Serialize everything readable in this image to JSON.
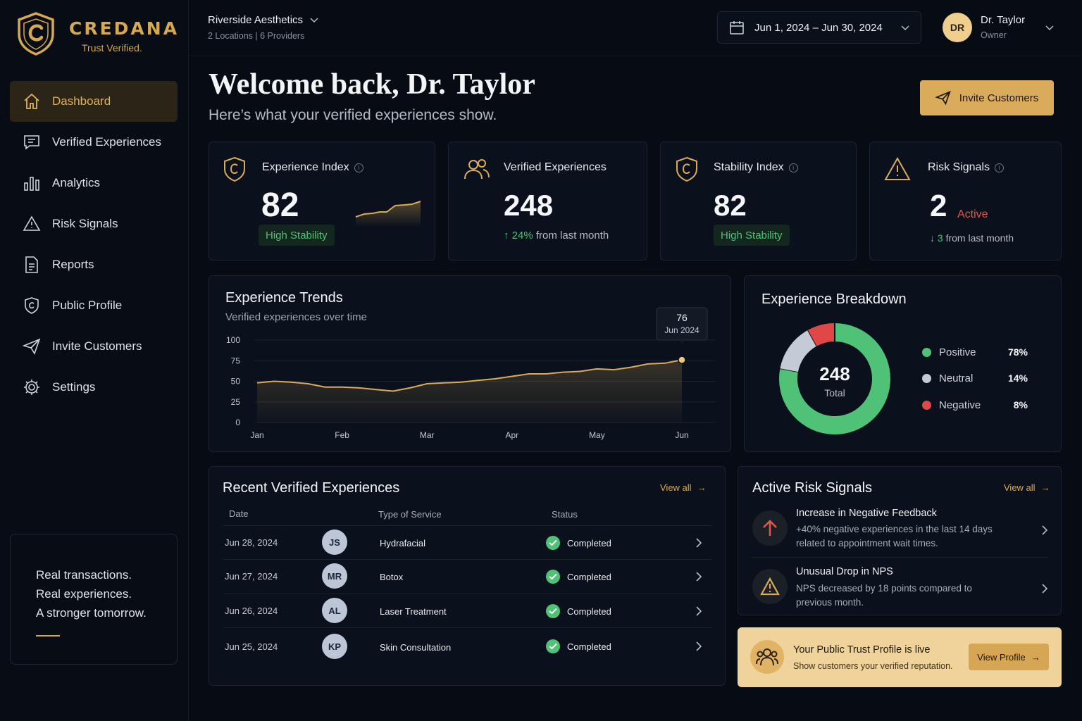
{
  "brand": {
    "name": "CREDANA",
    "tagline": "Trust Verified."
  },
  "sidebar": {
    "items": [
      {
        "label": "Dashboard",
        "icon": "home-icon"
      },
      {
        "label": "Verified Experiences",
        "icon": "message-icon"
      },
      {
        "label": "Analytics",
        "icon": "bar-chart-icon"
      },
      {
        "label": "Risk Signals",
        "icon": "warning-icon"
      },
      {
        "label": "Reports",
        "icon": "document-icon"
      },
      {
        "label": "Public Profile",
        "icon": "shield-icon"
      },
      {
        "label": "Invite Customers",
        "icon": "send-icon"
      },
      {
        "label": "Settings",
        "icon": "gear-icon"
      }
    ],
    "quote": [
      "Real transactions.",
      "Real experiences.",
      "A stronger tomorrow."
    ]
  },
  "header": {
    "org_name": "Riverside Aesthetics",
    "org_sub": "2 Locations  |  6 Providers",
    "date_range": "Jun 1, 2024 – Jun 30, 2024",
    "user_initials": "DR",
    "user_name": "Dr. Taylor",
    "user_role": "Owner"
  },
  "main": {
    "welcome": "Welcome back, Dr. Taylor",
    "welcome_sub": "Here’s what your verified experiences show.",
    "invite_label": "Invite Customers"
  },
  "kpis": {
    "experience_index": {
      "title": "Experience Index",
      "value": "82",
      "badge": "High Stability"
    },
    "verified": {
      "title": "Verified Experiences",
      "value": "248",
      "delta": "24%",
      "delta_text": "from last month"
    },
    "stability": {
      "title": "Stability Index",
      "value": "82",
      "badge": "High Stability"
    },
    "risk": {
      "title": "Risk Signals",
      "value": "2",
      "status": "Active",
      "delta": "3",
      "delta_text": "from last month"
    }
  },
  "trends": {
    "title": "Experience Trends",
    "subtitle": "Verified experiences over time",
    "tooltip_value": "76",
    "tooltip_label": "Jun 2024"
  },
  "chart_data": {
    "type": "area",
    "title": "Experience Trends",
    "subtitle": "Verified experiences over time",
    "categories": [
      "Jan",
      "Feb",
      "Mar",
      "Apr",
      "May",
      "Jun"
    ],
    "x": [
      0,
      0.2,
      0.4,
      0.6,
      0.8,
      1,
      1.2,
      1.4,
      1.6,
      1.8,
      2,
      2.2,
      2.4,
      2.6,
      2.8,
      3,
      3.2,
      3.4,
      3.6,
      3.8,
      4,
      4.2,
      4.4,
      4.6,
      4.8,
      5
    ],
    "values": [
      48,
      50,
      49,
      47,
      43,
      43,
      42,
      40,
      38,
      42,
      47,
      48,
      49,
      51,
      53,
      56,
      59,
      59,
      61,
      62,
      65,
      64,
      67,
      71,
      72,
      76
    ],
    "yticks": [
      0,
      25,
      50,
      75,
      100
    ],
    "ylim": [
      0,
      100
    ],
    "grid": true,
    "highlight": {
      "category": "Jun",
      "value": 76,
      "label": "Jun 2024"
    }
  },
  "breakdown": {
    "title": "Experience Breakdown",
    "total": "248",
    "total_label": "Total",
    "chart_data": {
      "type": "pie",
      "labels": [
        "Positive",
        "Neutral",
        "Negative"
      ],
      "values": [
        78,
        14,
        8
      ],
      "display": [
        "78%",
        "14%",
        "8%"
      ],
      "colors": [
        "#4fc277",
        "#c5cbd6",
        "#e04848"
      ]
    }
  },
  "recent": {
    "title": "Recent Verified Experiences",
    "view_all": "View all",
    "columns": [
      "Date",
      "Type of Service",
      "Status"
    ],
    "rows": [
      {
        "date": "Jun 28, 2024",
        "initials": "JS",
        "service": "Hydrafacial",
        "status": "Completed"
      },
      {
        "date": "Jun 27, 2024",
        "initials": "MR",
        "service": "Botox",
        "status": "Completed"
      },
      {
        "date": "Jun 26, 2024",
        "initials": "AL",
        "service": "Laser Treatment",
        "status": "Completed"
      },
      {
        "date": "Jun 25, 2024",
        "initials": "KP",
        "service": "Skin Consultation",
        "status": "Completed"
      }
    ]
  },
  "risks": {
    "title": "Active Risk Signals",
    "view_all": "View all",
    "items": [
      {
        "title": "Increase in Negative Feedback",
        "desc": "+40% negative experiences in the last 14 days related to appointment wait times.",
        "icon": "arrow-up-icon",
        "color": "#e0574a"
      },
      {
        "title": "Unusual Drop in NPS",
        "desc": "NPS decreased by 18 points compared to previous month.",
        "icon": "warning-icon",
        "color": "#d9ab5a"
      }
    ]
  },
  "profile_banner": {
    "title": "Your Public Trust Profile is live",
    "subtitle": "Show customers your verified reputation.",
    "button": "View Profile"
  },
  "colors": {
    "accent": "#d9ab5a",
    "positive": "#4fc277",
    "negative": "#e0574a",
    "background": "#060b14"
  }
}
